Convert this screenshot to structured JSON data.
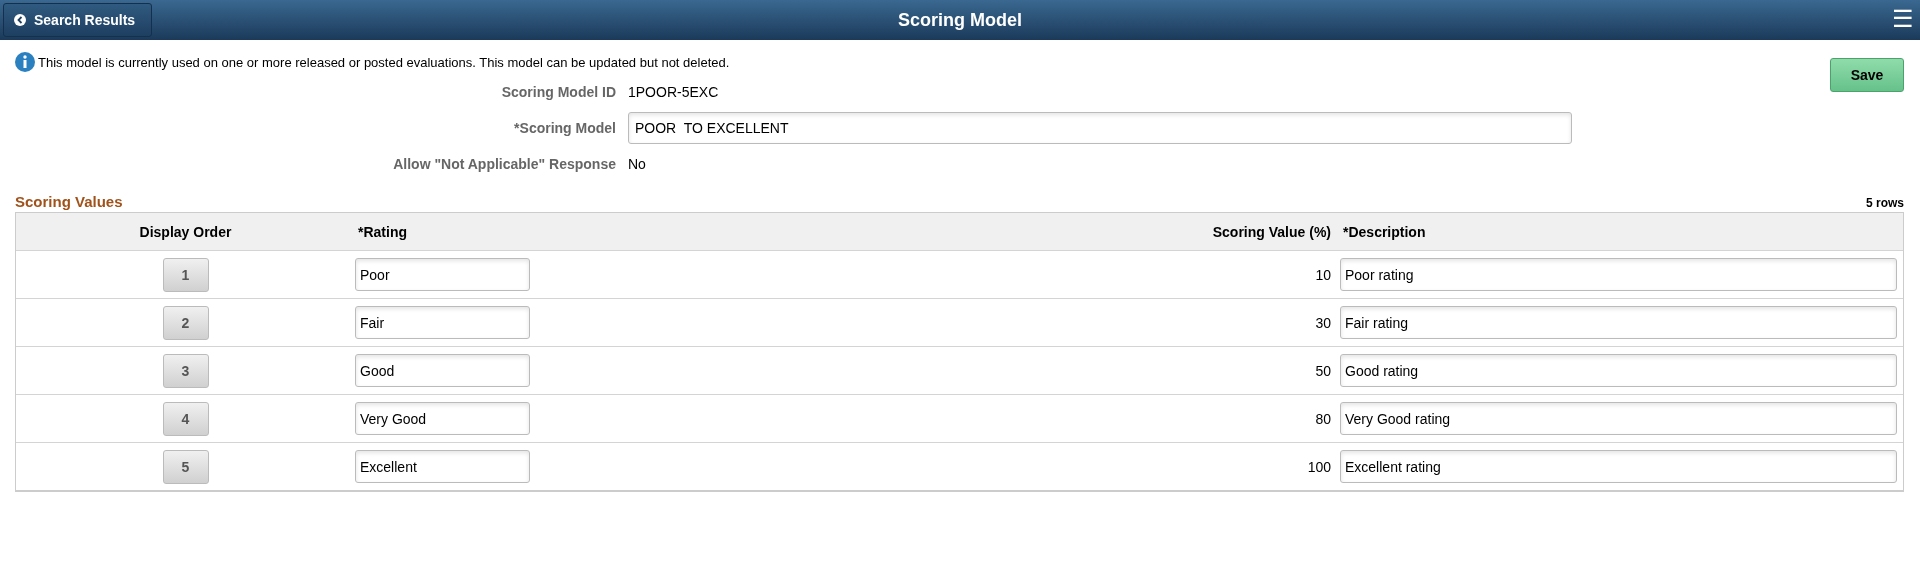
{
  "header": {
    "back_button": "Search Results",
    "title": "Scoring Model",
    "menu": "☰"
  },
  "message": "This model is currently used on one or more released or posted evaluations. This model can be updated but not deleted.",
  "save_button": "Save",
  "fields": [
    {
      "label": "Scoring Model ID",
      "kind": "text",
      "value": "1POOR-5EXC"
    },
    {
      "label": "*Scoring Model",
      "kind": "input",
      "value": "POOR  TO EXCELLENT"
    },
    {
      "label": "Allow \"Not Applicable\" Response",
      "kind": "text",
      "value": "No"
    }
  ],
  "scoring_values": {
    "title": "Scoring Values",
    "row_count": "5 rows",
    "columns": [
      "Display Order",
      "*Rating",
      "Scoring Value (%)",
      "*Description"
    ],
    "rows": [
      {
        "order": "1",
        "rating": "Poor",
        "value": "10",
        "description": "Poor rating"
      },
      {
        "order": "2",
        "rating": "Fair",
        "value": "30",
        "description": "Fair rating"
      },
      {
        "order": "3",
        "rating": "Good",
        "value": "50",
        "description": "Good rating"
      },
      {
        "order": "4",
        "rating": "Very Good",
        "value": "80",
        "description": "Very Good rating"
      },
      {
        "order": "5",
        "rating": "Excellent",
        "value": "100",
        "description": "Excellent rating"
      }
    ]
  }
}
